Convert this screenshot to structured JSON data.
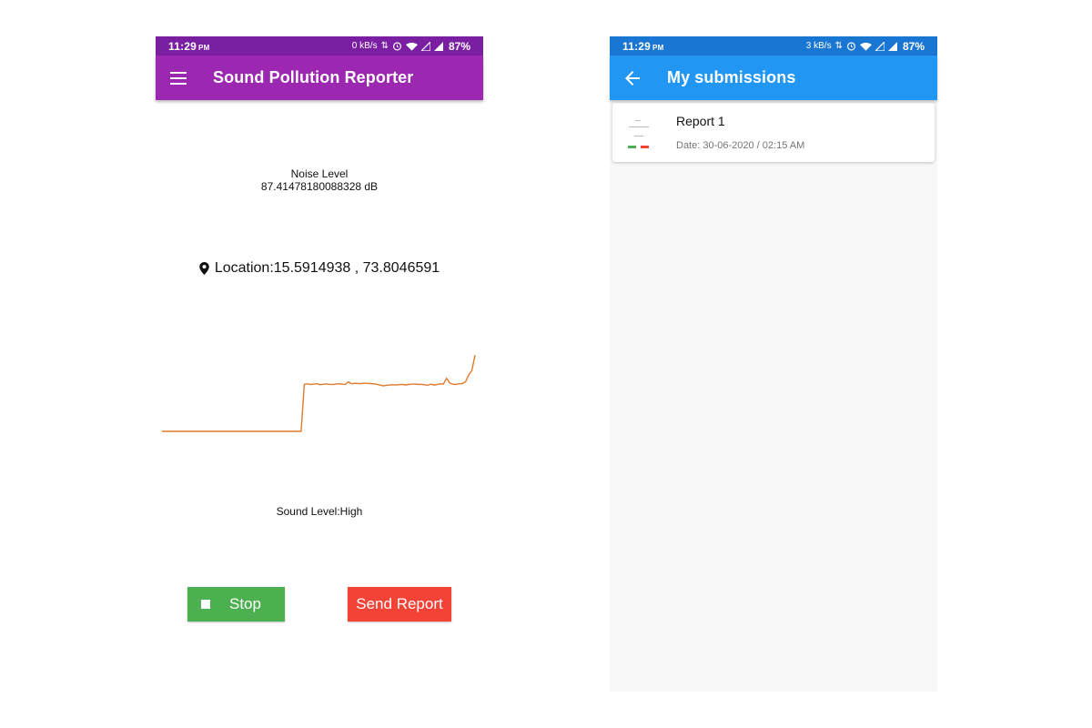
{
  "left_screen": {
    "status_bar": {
      "time": "11:29",
      "ampm": "PM",
      "net_speed": "0 kB/s",
      "battery": "87%"
    },
    "app_bar": {
      "menu_icon": "hamburger-menu-icon",
      "title": "Sound Pollution Reporter"
    },
    "noise_level_label": "Noise Level",
    "noise_level_value": "87.41478180088328 dB",
    "location_icon": "location-pin-icon",
    "location_text": "Location:15.5914938 , 73.8046591",
    "sound_level_text": "Sound Level:High",
    "stop_button_label": "Stop",
    "send_report_button_label": "Send Report",
    "colors": {
      "status": "#7b1fa2",
      "appbar": "#9c27b0",
      "stop": "#4caf50",
      "send": "#f44336",
      "line": "#e07a2c"
    }
  },
  "right_screen": {
    "status_bar": {
      "time": "11:29",
      "ampm": "PM",
      "net_speed": "3 kB/s",
      "battery": "87%"
    },
    "app_bar": {
      "back_icon": "arrow-back-icon",
      "title": "My submissions"
    },
    "submissions": [
      {
        "title": "Report 1",
        "date": "Date: 30-06-2020  /  02:15 AM"
      }
    ],
    "colors": {
      "status": "#1976d2",
      "appbar": "#2196f3"
    }
  },
  "chart_data": {
    "type": "line",
    "title": "",
    "xlabel": "",
    "ylabel": "",
    "x": [
      0,
      1,
      2,
      3,
      4,
      5,
      6,
      7,
      8,
      9,
      10,
      11,
      12,
      13,
      14,
      15,
      16,
      17,
      18,
      19,
      20,
      21,
      22,
      23,
      24,
      25,
      26,
      27,
      28,
      29,
      30,
      31,
      32,
      33,
      34,
      35,
      36,
      37,
      38,
      39,
      40,
      41,
      42,
      43,
      44,
      45,
      46,
      47,
      48,
      49,
      50,
      51,
      52,
      53,
      54,
      55,
      56,
      57,
      58,
      59,
      60,
      61,
      62,
      63,
      64,
      65,
      66,
      67,
      68,
      69,
      70,
      71,
      72,
      73,
      74,
      75,
      76,
      77,
      78,
      79,
      80,
      81,
      82,
      83,
      84,
      85,
      86,
      87,
      88,
      89,
      90,
      91,
      92,
      93,
      94,
      95,
      96,
      97,
      98,
      99
    ],
    "series": [
      {
        "values": [
          0,
          0,
          0,
          0,
          0,
          0,
          0,
          0,
          0,
          0,
          0,
          0,
          0,
          0,
          0,
          0,
          0,
          0,
          0,
          0,
          0,
          0,
          0,
          0,
          0,
          0,
          0,
          0,
          0,
          0,
          0,
          0,
          0,
          0,
          0,
          0,
          0,
          0,
          0,
          0,
          0,
          0,
          0,
          0,
          0,
          55,
          55.5,
          54.8,
          55.2,
          55.6,
          54.5,
          55.1,
          55.4,
          55,
          54.7,
          55.2,
          55.6,
          55.1,
          54.9,
          58,
          55.5,
          56.2,
          56,
          55.8,
          56.3,
          56.1,
          55.9,
          55.5,
          55,
          54,
          53.2,
          53.8,
          54.2,
          54.5,
          54.1,
          54.6,
          54.9,
          54.3,
          54.8,
          55.1,
          55.4,
          54.8,
          55,
          54.5,
          53.8,
          55.2,
          54.2,
          54.8,
          55.5,
          55.3,
          62,
          56.5,
          55.1,
          54.8,
          55.6,
          56,
          58,
          66,
          71,
          89
        ]
      }
    ],
    "ylim": [
      0,
      100
    ],
    "grid": false,
    "legend": "none"
  }
}
